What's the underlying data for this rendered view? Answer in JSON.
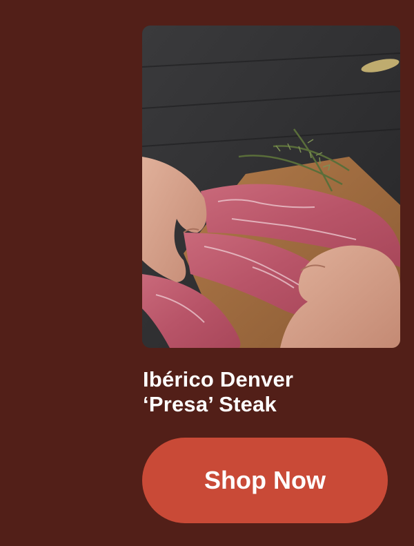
{
  "product": {
    "image_alt": "Hands arranging raw Ibérico presa steak on a wooden board with rosemary",
    "title_line1": "Ibérico Denver",
    "title_line2": "‘Presa’ Steak"
  },
  "cta": {
    "label": "Shop Now"
  },
  "colors": {
    "background": "#521f18",
    "button": "#c94a37",
    "text": "#ffffff"
  }
}
